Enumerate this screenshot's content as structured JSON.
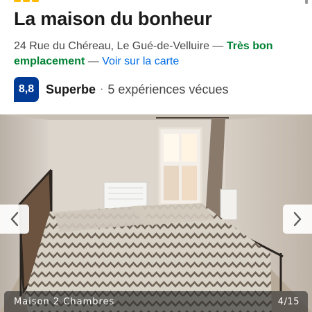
{
  "header": {
    "title": "La maison du bonheur",
    "address": "24 Rue du Chéreau, Le Gué-de-Velluire",
    "separator": " — ",
    "location_badge": "Très bon emplacement",
    "map_link": "Voir sur la carte"
  },
  "rating": {
    "score": "8,8",
    "label": "Superbe",
    "separator": "·",
    "reviews": "5 expériences vécues"
  },
  "gallery": {
    "caption": "Maison 2 Chambres",
    "counter": "4/15",
    "prev_icon": "chevron-left-icon",
    "next_icon": "chevron-right-icon"
  },
  "colors": {
    "brand_blue": "#003b95",
    "link_blue": "#006ce4",
    "location_green": "#008234",
    "star_yellow": "#febb02"
  }
}
